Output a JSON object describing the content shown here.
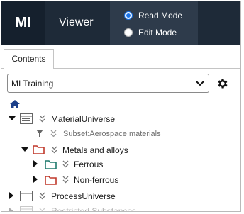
{
  "header": {
    "logo_text": "MI",
    "app_title": "Viewer",
    "modes": [
      {
        "label": "Read Mode",
        "selected": true
      },
      {
        "label": "Edit Mode",
        "selected": false
      }
    ]
  },
  "tabs": [
    {
      "label": "Contents",
      "active": true
    }
  ],
  "database_select": {
    "value": "MI Training"
  },
  "icons": {
    "home": "home-icon",
    "settings": "gear-icon",
    "expand": "caret-icon",
    "table": "table-icon",
    "folder": "folder-icon",
    "filter": "filter-icon",
    "double_chevron": "double-chevron-icon"
  },
  "colors": {
    "header_bg": "#1e2a38",
    "mode_panel_bg": "#2e3b4b",
    "accent_blue": "#1a73e8",
    "folder_red": "#c0392b",
    "folder_teal": "#1f7a6d"
  },
  "tree": {
    "material_universe": "MaterialUniverse",
    "subset_label": "Subset:Aerospace materials",
    "metals_and_alloys": "Metals and alloys",
    "ferrous": "Ferrous",
    "non_ferrous": "Non-ferrous",
    "process_universe": "ProcessUniverse",
    "restricted_substances": "Restricted Substances"
  }
}
